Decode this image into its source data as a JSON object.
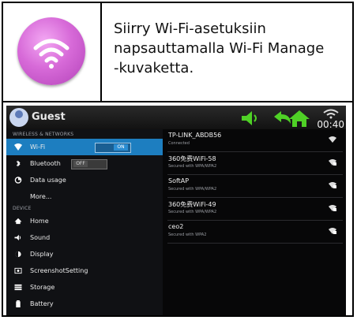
{
  "instruction": {
    "lines": [
      "Siirry Wi-Fi-asetuksiin",
      "napsauttamalla Wi-Fi Manage",
      "-kuvaketta."
    ],
    "icon": "wifi-manage-icon"
  },
  "statusbar": {
    "user": "Guest",
    "time": "00:40"
  },
  "settings": {
    "sections": {
      "wireless": "WIRELESS & NETWORKS",
      "device": "DEVICE"
    },
    "items": [
      {
        "label": "Wi-Fi",
        "icon": "wifi-icon",
        "toggle": "ON",
        "active": true
      },
      {
        "label": "Bluetooth",
        "icon": "bluetooth-icon",
        "toggle": "OFF"
      },
      {
        "label": "Data usage",
        "icon": "data-usage-icon"
      },
      {
        "label": "More...",
        "icon": ""
      },
      {
        "label": "Home",
        "icon": "home-icon"
      },
      {
        "label": "Sound",
        "icon": "sound-icon"
      },
      {
        "label": "Display",
        "icon": "display-icon"
      },
      {
        "label": "ScreenshotSetting",
        "icon": "screenshot-icon"
      },
      {
        "label": "Storage",
        "icon": "storage-icon"
      },
      {
        "label": "Battery",
        "icon": "battery-icon"
      }
    ]
  },
  "networks": [
    {
      "name": "TP-LINK_ABDB56",
      "status": "Connected"
    },
    {
      "name": "360免费WiFi-58",
      "status": "Secured with WPA/WPA2"
    },
    {
      "name": "SoftAP",
      "status": "Secured with WPA/WPA2"
    },
    {
      "name": "360免费WiFi-49",
      "status": "Secured with WPA/WPA2"
    },
    {
      "name": "ceo2",
      "status": "Secured with WPA2"
    }
  ],
  "colors": {
    "accent": "#1d7ec0",
    "status_green": "#4fd126",
    "badge_purple": "#c85ccb"
  }
}
